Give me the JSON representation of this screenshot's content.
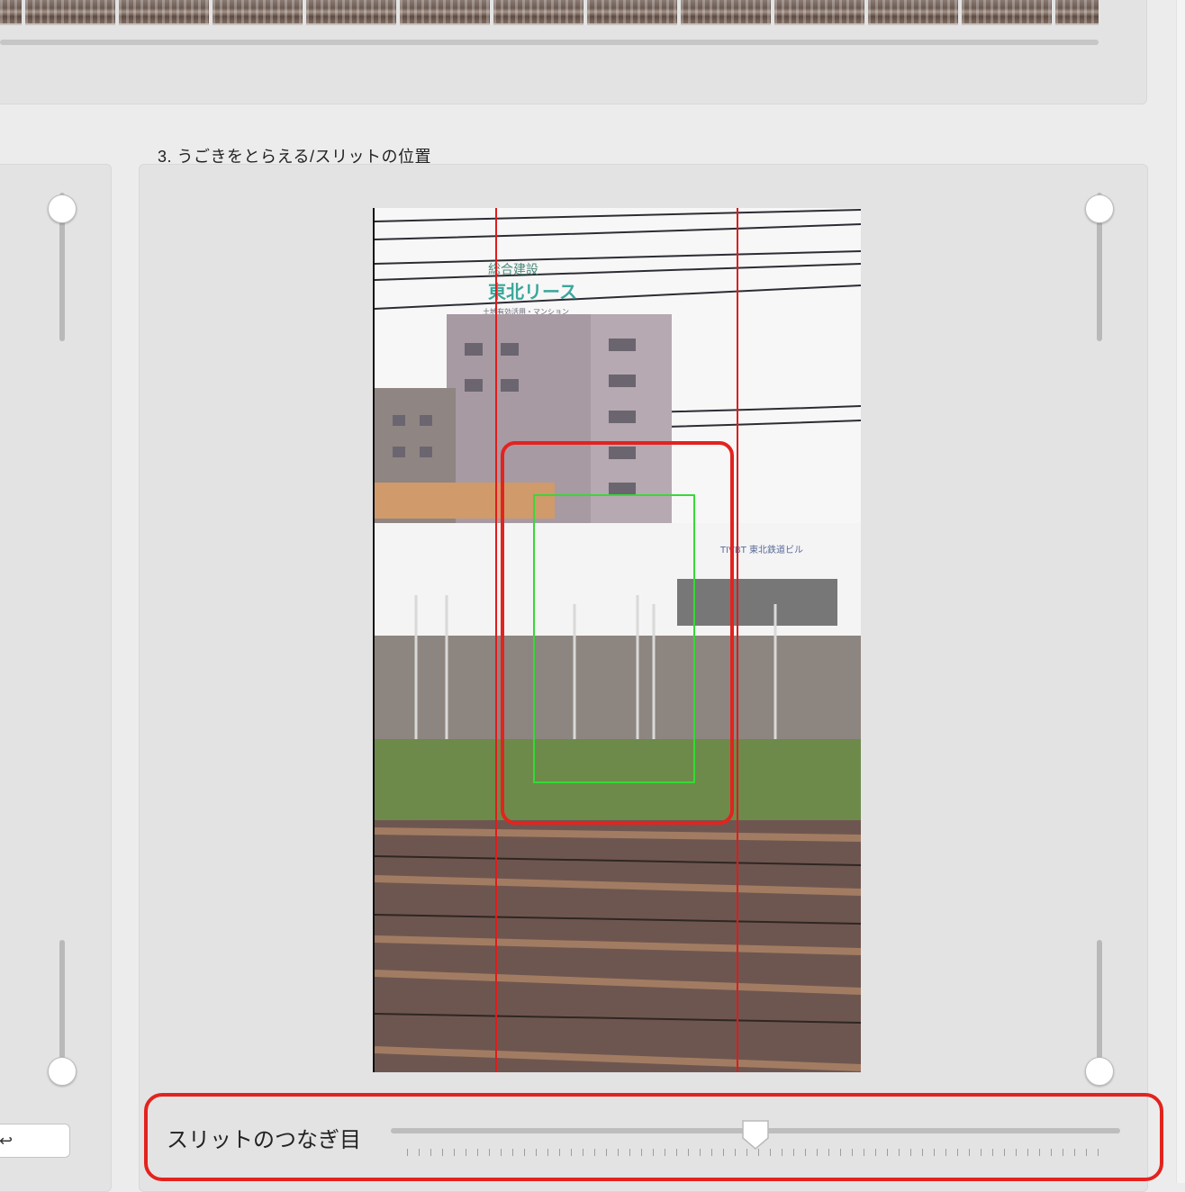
{
  "sections": {
    "motion_title": "3. うごきをとらえる/スリットの位置"
  },
  "left_panel": {
    "button_label": "↩"
  },
  "joint_slider": {
    "label": "スリットのつなぎ目",
    "value_fraction": 0.5
  },
  "preview": {
    "sign_line1": "総合建設",
    "sign_line2": "東北リース",
    "sign_line3": "土地有効活用・マンション",
    "building_sign": "TIVBT 東北鉄道ビル"
  },
  "colors": {
    "slit_line": "#e01b1b",
    "target_box": "#36d936",
    "callout": "#e3231f"
  },
  "icons": [
    "return-icon"
  ]
}
